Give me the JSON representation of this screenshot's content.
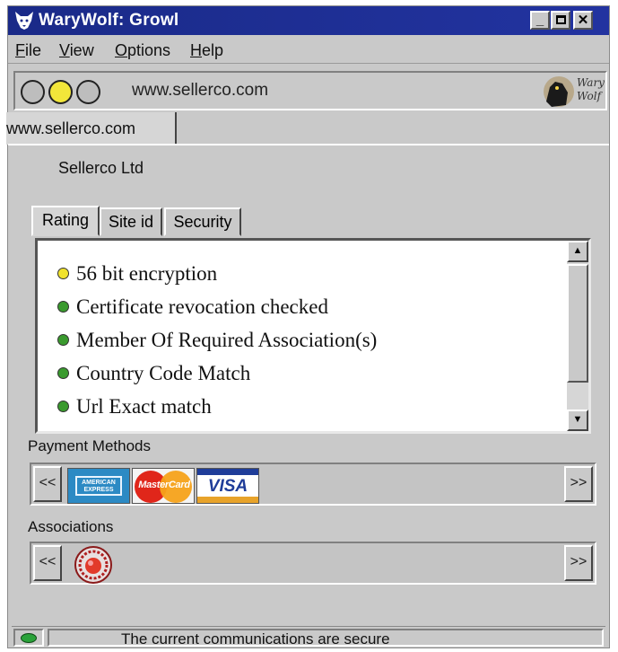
{
  "window": {
    "title": "WaryWolf: Growl"
  },
  "menu": [
    {
      "key": "F",
      "rest": "ile"
    },
    {
      "key": "V",
      "rest": "iew"
    },
    {
      "key": "O",
      "rest": "ptions"
    },
    {
      "key": "H",
      "rest": "elp"
    }
  ],
  "address": {
    "url": "www.sellerco.com"
  },
  "brand": {
    "line1": "Wary",
    "line2": "Wolf"
  },
  "site_tab": {
    "label": "www.sellerco.com"
  },
  "company": {
    "name": "Sellerco Ltd"
  },
  "tabs": [
    "Rating",
    "Site id",
    "Security"
  ],
  "rating": {
    "items": [
      {
        "text": "56 bit encryption",
        "color": "#f0e22e"
      },
      {
        "text": "Certificate revocation checked",
        "color": "#3a9a2e"
      },
      {
        "text": "Member Of Required Association(s)",
        "color": "#3a9a2e"
      },
      {
        "text": "Country Code Match",
        "color": "#3a9a2e"
      },
      {
        "text": "Url Exact match",
        "color": "#3a9a2e"
      }
    ]
  },
  "payment": {
    "label": "Payment Methods",
    "prev": "<<",
    "next": ">>",
    "cards": {
      "amex": "AMERICAN EXPRESS",
      "mastercard": "MasterCard",
      "visa": "VISA"
    }
  },
  "associations": {
    "label": "Associations",
    "prev": "<<",
    "next": ">>"
  },
  "status": {
    "text": "The current communications are secure",
    "led_color": "#2aa23a"
  }
}
